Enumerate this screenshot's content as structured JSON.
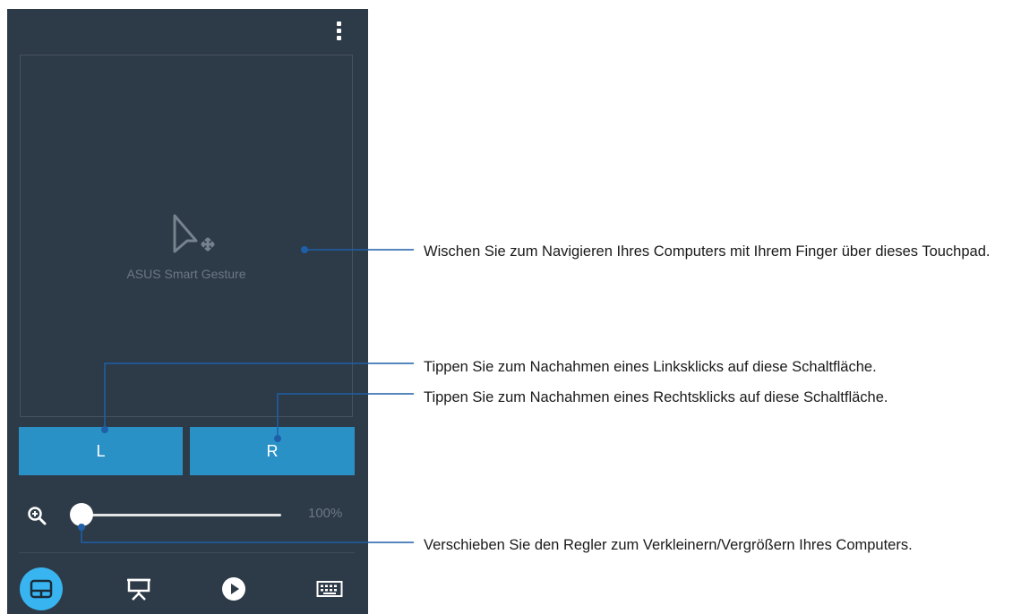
{
  "app": {
    "touchpad_label": "ASUS Smart Gesture",
    "left_button": "L",
    "right_button": "R",
    "zoom_value": "100%",
    "zoom_level": 0.0,
    "menu_icon": "more-vert-icon",
    "nav_tabs": [
      {
        "name": "touchpad",
        "icon": "touchpad-icon",
        "active": true
      },
      {
        "name": "presentation",
        "icon": "presentation-icon",
        "active": false
      },
      {
        "name": "media",
        "icon": "play-icon",
        "active": false
      },
      {
        "name": "keyboard",
        "icon": "keyboard-icon",
        "active": false
      }
    ],
    "colors": {
      "background": "#2d3a47",
      "button": "#2a91c7",
      "active_tab": "#38b5f0",
      "leader_line": "#1f5fa8"
    }
  },
  "callouts": {
    "touchpad": "Wischen Sie zum Navigieren Ihres Computers mit Ihrem Finger über dieses Touchpad.",
    "left_click": "Tippen Sie zum Nachahmen eines Linksklicks auf diese Schaltfläche.",
    "right_click": "Tippen Sie zum Nachahmen eines Rechtsklicks auf diese Schaltfläche.",
    "slider": "Verschieben Sie den Regler zum Verkleinern/Vergrößern Ihres Computers."
  }
}
